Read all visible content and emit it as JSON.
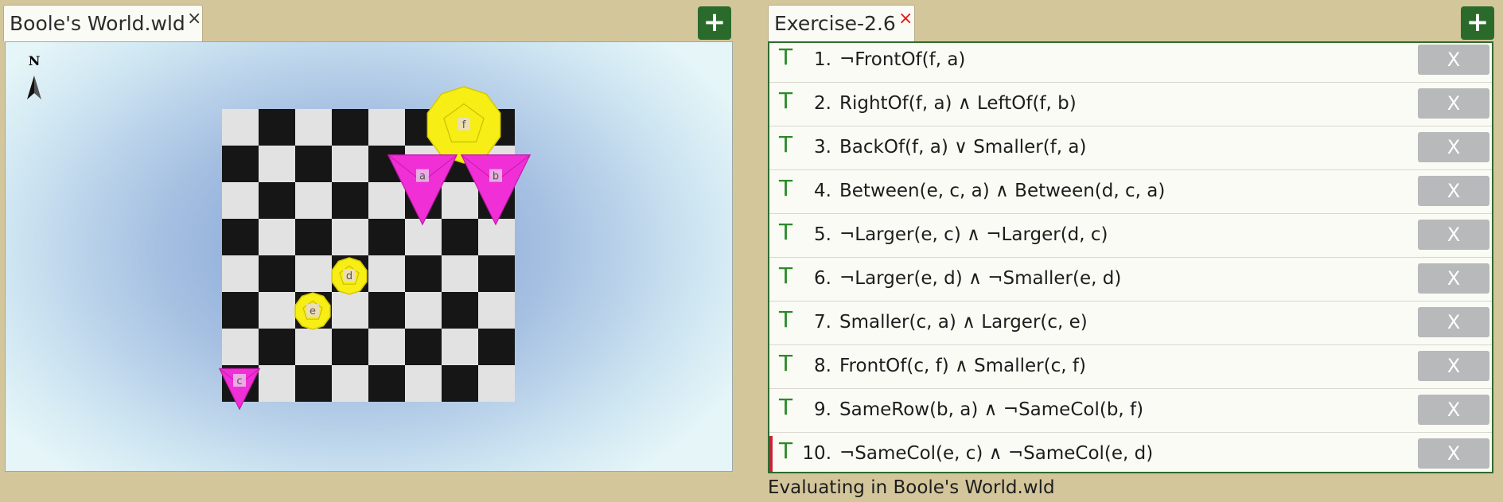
{
  "left_tab": {
    "title": "Boole's World.wld",
    "close": "×"
  },
  "right_tab": {
    "title": "Exercise-2.6",
    "close": "×"
  },
  "add_button_label": "+",
  "world": {
    "compass": "N",
    "objects": [
      {
        "label": "f",
        "shape": "dodecahedron",
        "size": "large",
        "color": "#f6ee14"
      },
      {
        "label": "a",
        "shape": "tetrahedron",
        "size": "large",
        "color": "#f02fd7"
      },
      {
        "label": "b",
        "shape": "tetrahedron",
        "size": "large",
        "color": "#f02fd7"
      },
      {
        "label": "d",
        "shape": "dodecahedron",
        "size": "small",
        "color": "#f6ee14"
      },
      {
        "label": "e",
        "shape": "dodecahedron",
        "size": "small",
        "color": "#f6ee14"
      },
      {
        "label": "c",
        "shape": "tetrahedron",
        "size": "small",
        "color": "#f02fd7"
      }
    ]
  },
  "sentences": [
    {
      "num": "1.",
      "truth": "T",
      "formula": "¬FrontOf(f, a)",
      "delete": "X"
    },
    {
      "num": "2.",
      "truth": "T",
      "formula": "RightOf(f, a) ∧ LeftOf(f, b)",
      "delete": "X"
    },
    {
      "num": "3.",
      "truth": "T",
      "formula": "BackOf(f, a) ∨ Smaller(f, a)",
      "delete": "X"
    },
    {
      "num": "4.",
      "truth": "T",
      "formula": "Between(e, c, a) ∧ Between(d, c, a)",
      "delete": "X"
    },
    {
      "num": "5.",
      "truth": "T",
      "formula": "¬Larger(e, c) ∧ ¬Larger(d, c)",
      "delete": "X"
    },
    {
      "num": "6.",
      "truth": "T",
      "formula": "¬Larger(e, d) ∧ ¬Smaller(e, d)",
      "delete": "X"
    },
    {
      "num": "7.",
      "truth": "T",
      "formula": "Smaller(c, a) ∧ Larger(c, e)",
      "delete": "X"
    },
    {
      "num": "8.",
      "truth": "T",
      "formula": "FrontOf(c, f) ∧ Smaller(c, f)",
      "delete": "X"
    },
    {
      "num": "9.",
      "truth": "T",
      "formula": "SameRow(b, a) ∧ ¬SameCol(b, f)",
      "delete": "X"
    },
    {
      "num": "10.",
      "truth": "T",
      "formula": "¬SameCol(e, c) ∧ ¬SameCol(e, d)",
      "delete": "X"
    }
  ],
  "status": "Evaluating in Boole's World.wld",
  "colors": {
    "accent_green": "#2a6b2c",
    "truth_green": "#2a8a2a",
    "current_marker": "#c8223a"
  }
}
